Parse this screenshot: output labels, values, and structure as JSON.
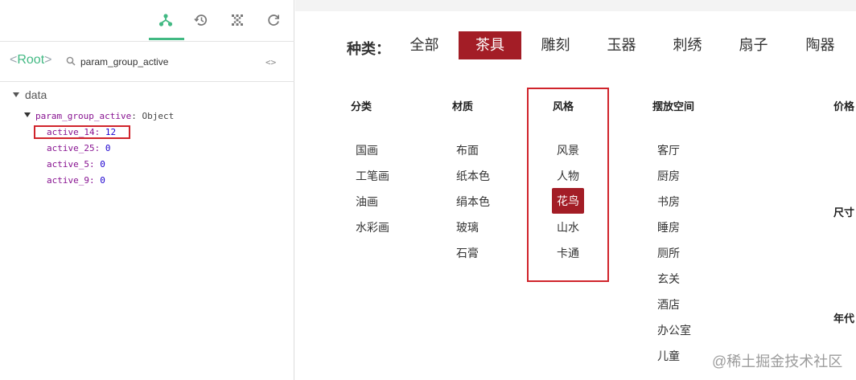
{
  "devtools": {
    "toolbar": [
      {
        "icon": "components-icon",
        "label": "Components",
        "active": true
      },
      {
        "icon": "history-icon",
        "label": "Timeline",
        "active": false
      },
      {
        "icon": "vuex-icon",
        "label": "Vuex",
        "active": false
      },
      {
        "icon": "refresh-icon",
        "label": "Refresh",
        "active": false
      }
    ],
    "root_label": "Root",
    "root_open": "<",
    "root_close": ">",
    "search": {
      "value": "param_group_active",
      "placeholder": ""
    },
    "code_toggle": "<>",
    "tree": {
      "section": "data",
      "object_key": "param_group_active",
      "object_type": ": Object",
      "rows": [
        {
          "key": "active_14",
          "value": "12"
        },
        {
          "key": "active_25",
          "value": "0"
        },
        {
          "key": "active_5",
          "value": "0"
        },
        {
          "key": "active_9",
          "value": "0"
        }
      ]
    },
    "accent_color": "#42b983"
  },
  "page": {
    "category_label": "种类：",
    "category_tabs": [
      "全部",
      "茶具",
      "雕刻",
      "玉器",
      "刺绣",
      "扇子",
      "陶器"
    ],
    "active_tab": "茶具",
    "brand_color": "#a31d26",
    "columns": [
      {
        "title": "分类",
        "options": [
          "国画",
          "工笔画",
          "油画",
          "水彩画"
        ]
      },
      {
        "title": "材质",
        "options": [
          "布面",
          "纸本色",
          "绢本色",
          "玻璃",
          "石膏"
        ]
      },
      {
        "title": "风格",
        "options": [
          "风景",
          "人物",
          "花鸟",
          "山水",
          "卡通"
        ],
        "selected": "花鸟"
      },
      {
        "title": "摆放空间",
        "options": [
          "客厅",
          "厨房",
          "书房",
          "睡房",
          "厕所",
          "玄关",
          "酒店",
          "办公室",
          "儿童"
        ]
      }
    ],
    "side_labels": [
      "价格",
      "尺寸",
      "年代"
    ],
    "watermark": "@稀土掘金技术社区"
  }
}
